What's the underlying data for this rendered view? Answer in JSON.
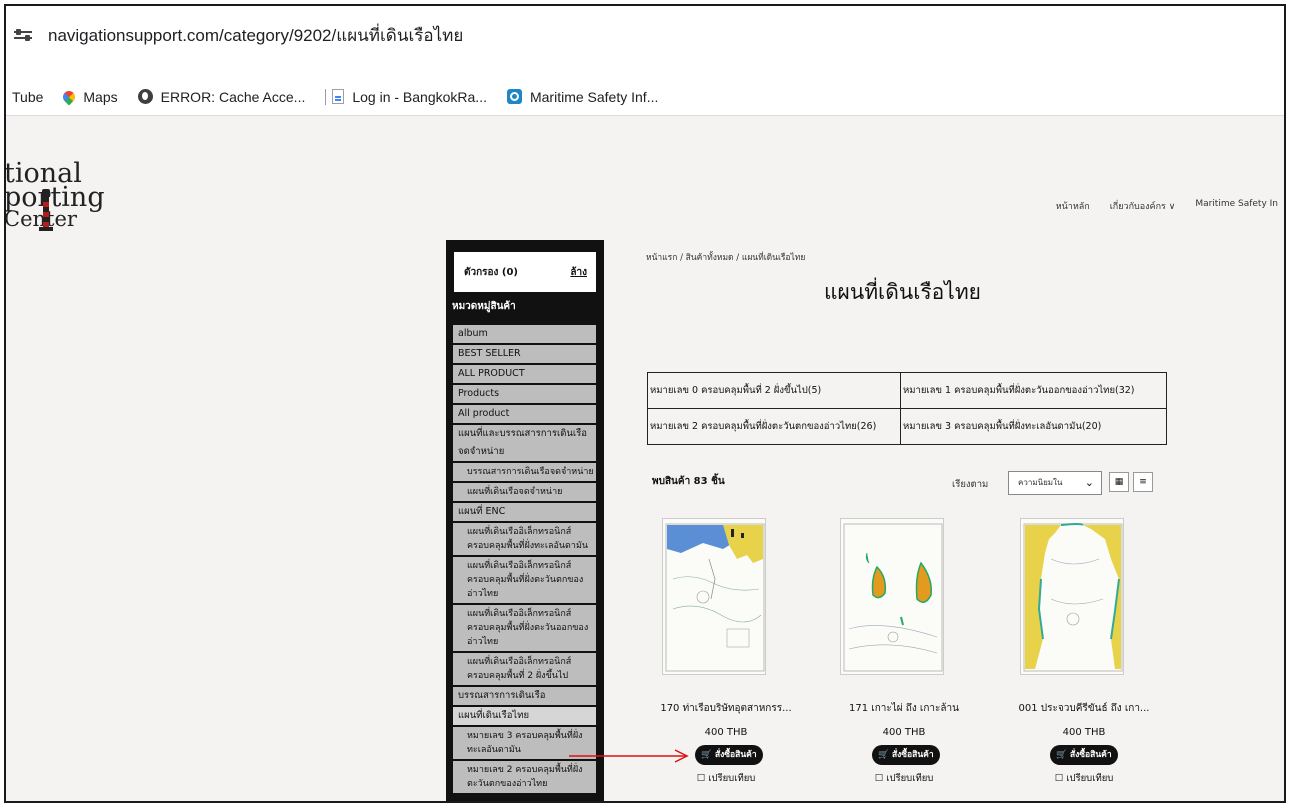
{
  "browser": {
    "url": "navigationsupport.com/category/9202/แผนที่เดินเรือไทย",
    "bookmarks": [
      {
        "label": "Tube",
        "icon": "youtube-icon"
      },
      {
        "label": "Maps",
        "icon": "maps-icon"
      },
      {
        "label": "ERROR: Cache Acce...",
        "icon": "globe-icon"
      },
      {
        "label": "Log in - BangkokRa...",
        "icon": "document-icon"
      },
      {
        "label": "Maritime Safety Inf...",
        "icon": "msi-icon"
      }
    ]
  },
  "logo": {
    "line1": "tional",
    "line2": "porting",
    "line3": "Center"
  },
  "nav": {
    "home": "หน้าหลัก",
    "about": "เกี่ยวกับองค์กร ∨",
    "msi": "Maritime Safety In"
  },
  "sidebar": {
    "filter_label": "ตัวกรอง (0)",
    "clear_label": "ล้าง",
    "category_title": "หมวดหมู่สินค้า",
    "items": [
      {
        "label": "album",
        "sub": false
      },
      {
        "label": "BEST SELLER",
        "sub": false
      },
      {
        "label": "ALL PRODUCT",
        "sub": false
      },
      {
        "label": "Products",
        "sub": false
      },
      {
        "label": "All product",
        "sub": false
      },
      {
        "label": "แผนที่และบรรณสารการเดินเรือจดจำหน่าย",
        "sub": false
      },
      {
        "label": "บรรณสารการเดินเรือจดจำหน่าย",
        "sub": true
      },
      {
        "label": "แผนที่เดินเรือจดจำหน่าย",
        "sub": true
      },
      {
        "label": "แผนที่ ENC",
        "sub": false
      },
      {
        "label": "แผนที่เดินเรืออิเล็กทรอนิกส์ ครอบคลุมพื้นที่ฝั่งทะเลอันดามัน",
        "sub": true
      },
      {
        "label": "แผนที่เดินเรืออิเล็กทรอนิกส์ ครอบคลุมพื้นที่ฝั่งตะวันตกของอ่าวไทย",
        "sub": true
      },
      {
        "label": "แผนที่เดินเรืออิเล็กทรอนิกส์ ครอบคลุมพื้นที่ฝั่งตะวันออกของอ่าวไทย",
        "sub": true
      },
      {
        "label": "แผนที่เดินเรืออิเล็กทรอนิกส์ ครอบคลุมพื้นที่ 2 ฝั่งขึ้นไป",
        "sub": true
      },
      {
        "label": "บรรณสารการเดินเรือ",
        "sub": false
      },
      {
        "label": "แผนที่เดินเรือไทย",
        "sub": false
      },
      {
        "label": "หมายเลข 3 ครอบคลุมพื้นที่ฝั่งทะเลอันดามัน",
        "sub": true
      },
      {
        "label": "หมายเลข 2 ครอบคลุมพื้นที่ฝั่งตะวันตกของอ่าวไทย",
        "sub": true
      }
    ]
  },
  "main": {
    "breadcrumb": "หน้าแรก / สินค้าทั้งหมด / แผนที่เดินเรือไทย",
    "title": "แผนที่เดินเรือไทย",
    "subcategories": [
      [
        "หมายเลข 0 ครอบคลุมพื้นที่ 2 ฝั่งขึ้นไป(5)",
        "หมายเลข 1 ครอบคลุมพื้นที่ฝั่งตะวันออกของอ่าวไทย(32)"
      ],
      [
        "หมายเลข 2 ครอบคลุมพื้นที่ฝั่งตะวันตกของอ่าวไทย(26)",
        "หมายเลข 3 ครอบคลุมพื้นที่ฝั่งทะเลอันดามัน(20)"
      ]
    ],
    "count_text": "พบสินค้า 83 ชิ้น",
    "sort_label": "เรียงตาม",
    "sort_value": "ความนิยมใน",
    "grid_icon": "grid-view-icon",
    "list_icon": "list-view-icon",
    "products": [
      {
        "name": "170 ท่าเรือบริษัทอุตสาหกรร...",
        "price": "400 THB",
        "buy": "สั่งซื้อสินค้า",
        "compare": "☐ เปรียบเทียบ"
      },
      {
        "name": "171 เกาะไผ่ ถึง เกาะล้าน",
        "price": "400 THB",
        "buy": "สั่งซื้อสินค้า",
        "compare": "☐ เปรียบเทียบ"
      },
      {
        "name": "001 ประจวบคีรีขันธ์ ถึง เกา...",
        "price": "400 THB",
        "buy": "สั่งซื้อสินค้า",
        "compare": "☐ เปรียบเทียบ"
      }
    ]
  },
  "colors": {
    "annotation_arrow": "#e01010",
    "sidebar_bg": "#111111",
    "button_bg": "#111111"
  }
}
